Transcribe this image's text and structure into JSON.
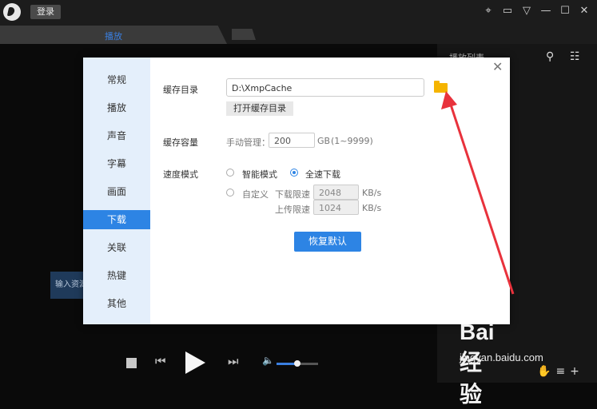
{
  "topbar": {
    "login_label": "登录"
  },
  "tabs": {
    "active_label": "播放"
  },
  "playlist": {
    "title": "播放列表"
  },
  "background": {
    "input_hint": "输入资源"
  },
  "player": {
    "volume_percent": 50
  },
  "dialog": {
    "nav": [
      "常规",
      "播放",
      "声音",
      "字幕",
      "画面",
      "下载",
      "关联",
      "热键",
      "其他"
    ],
    "active_nav": "下载",
    "cache_dir": {
      "label": "缓存目录",
      "value": "D:\\XmpCache",
      "open_button": "打开缓存目录"
    },
    "cache_capacity": {
      "label": "缓存容量",
      "sub_label": "手动管理：",
      "value": "200",
      "unit": "GB",
      "range": "(1~9999)"
    },
    "speed_mode": {
      "label": "速度模式",
      "options": [
        "智能模式",
        "全速下载",
        "自定义"
      ],
      "selected": "全速下载",
      "download_limit": {
        "label": "下载限速",
        "value": "2048",
        "unit": "KB/s"
      },
      "upload_limit": {
        "label": "上传限速",
        "value": "1024",
        "unit": "KB/s"
      }
    },
    "restore_button": "恢复默认"
  },
  "watermark": {
    "text": "Bai 经验",
    "url_text": "jingyan.baidu.com"
  },
  "colors": {
    "accent": "#2d84e4",
    "arrow": "#e8323c",
    "folder": "#f5b400"
  }
}
